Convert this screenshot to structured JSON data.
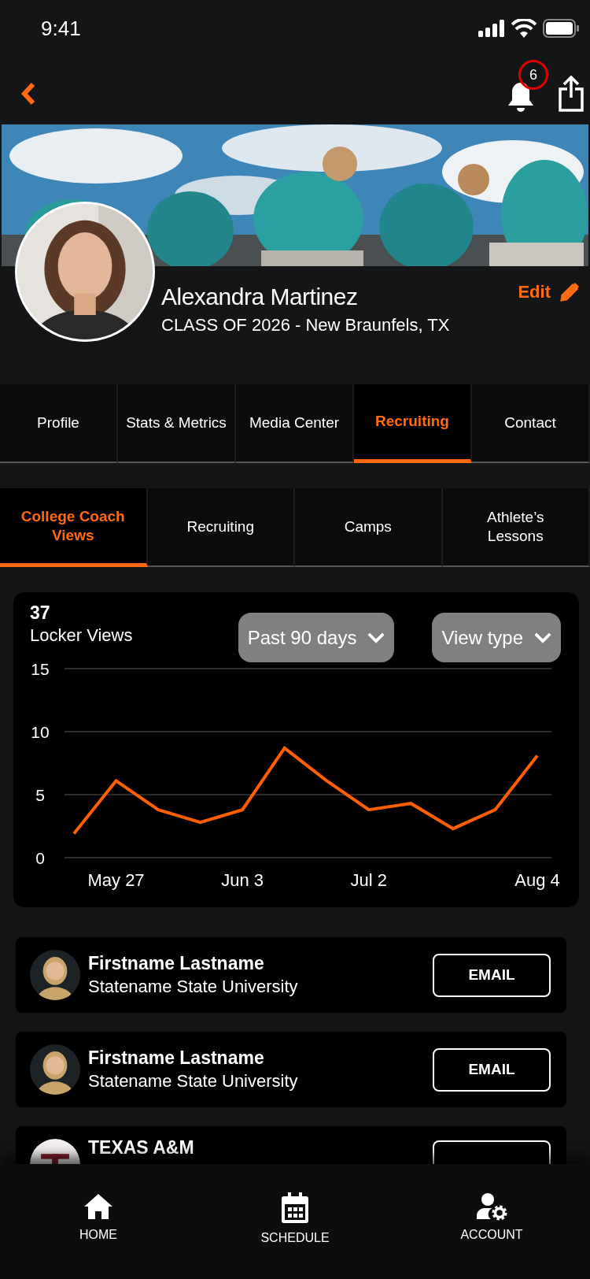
{
  "status_bar": {
    "time": "9:41"
  },
  "top_bar": {
    "notification_count": "6"
  },
  "profile": {
    "name": "Alexandra Martinez",
    "subtitle": "CLASS OF 2026 - New Braunfels, TX",
    "edit_label": "Edit"
  },
  "tabs": [
    {
      "label": "Profile",
      "selected": false
    },
    {
      "label": "Stats & Metrics",
      "selected": false
    },
    {
      "label": "Media Center",
      "selected": false
    },
    {
      "label": "Recruiting",
      "selected": true
    },
    {
      "label": "Contact",
      "selected": false
    }
  ],
  "sub_tabs": [
    {
      "label": "College Coach Views",
      "selected": true
    },
    {
      "label": "Recruiting",
      "selected": false
    },
    {
      "label": "Camps",
      "selected": false
    },
    {
      "label": "Athlete’s Lessons",
      "selected": false
    }
  ],
  "views_card": {
    "count": "37",
    "label": "Locker Views",
    "filters": [
      "Past 90 days",
      "View type"
    ],
    "chart_data": {
      "type": "line",
      "categories": [
        null,
        "May 27",
        null,
        null,
        "Jun 3",
        null,
        null,
        "Jul 2",
        null,
        null,
        null,
        "Aug 4"
      ],
      "ylim": [
        0,
        15
      ],
      "yticks": [
        0,
        5,
        10,
        15
      ],
      "series": [
        {
          "color": "#ff5f00",
          "values": [
            1.9,
            6.1,
            3.8,
            2.8,
            3.8,
            8.7,
            6.1,
            3.8,
            4.3,
            2.3,
            3.8,
            8.1
          ]
        }
      ]
    }
  },
  "coaches": [
    {
      "kind": "person",
      "name": "Firstname Lastname",
      "school": "Statename State University",
      "button": "EMAIL"
    },
    {
      "kind": "person",
      "name": "Firstname Lastname",
      "school": "Statename State University",
      "button": "EMAIL"
    },
    {
      "kind": "school_logo",
      "name": "TEXAS A&M"
    }
  ],
  "bottom_nav": [
    {
      "label": "HOME"
    },
    {
      "label": "SCHEDULE"
    },
    {
      "label": "ACCOUNT"
    }
  ]
}
